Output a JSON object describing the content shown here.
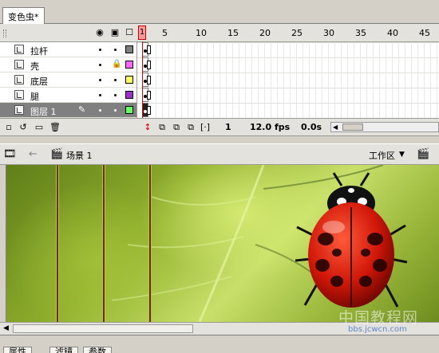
{
  "document": {
    "tab_title": "变色虫*"
  },
  "timeline": {
    "header": {
      "eye_icon": "eye-icon",
      "lock_icon": "lock-icon",
      "outline_icon": "outline-icon",
      "current_frame_marker": "1"
    },
    "ruler_ticks": [
      "5",
      "10",
      "15",
      "20",
      "25",
      "30",
      "35",
      "40",
      "45"
    ],
    "layers": [
      {
        "name": "拉杆",
        "locked": false,
        "color": "#808080",
        "selected": false
      },
      {
        "name": "壳",
        "locked": true,
        "color": "#ff66ff",
        "selected": false
      },
      {
        "name": "底层",
        "locked": false,
        "color": "#ffff66",
        "selected": false
      },
      {
        "name": "腿",
        "locked": false,
        "color": "#9933cc",
        "selected": false
      },
      {
        "name": "图层 1",
        "locked": false,
        "color": "#66ff66",
        "selected": true
      }
    ],
    "status": {
      "frame": "1",
      "fps": "12.0 fps",
      "time": "0.0s"
    }
  },
  "editbar": {
    "scene_label": "场景 1",
    "workspace_label": "工作区"
  },
  "property_tabs": [
    "属性",
    "滤镜",
    "参数"
  ],
  "watermark": {
    "title": "中国教程网",
    "url": "bbs.jcwcn.com"
  }
}
